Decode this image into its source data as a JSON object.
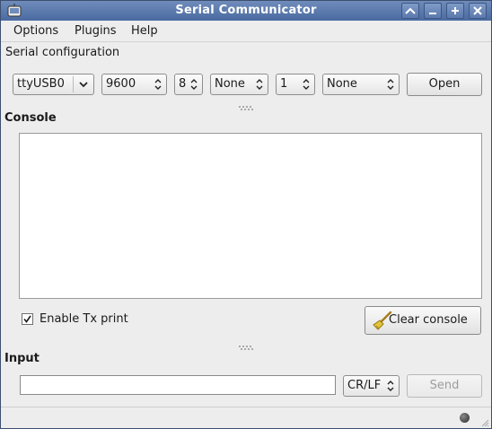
{
  "window": {
    "title": "Serial Communicator",
    "buttons": [
      "up-icon",
      "minimize-icon",
      "maximize-icon",
      "close-icon"
    ]
  },
  "menu": {
    "options": "Options",
    "plugins": "Plugins",
    "help": "Help"
  },
  "serial_config": {
    "label": "Serial configuration",
    "port": "ttyUSB0",
    "baud": "9600",
    "data_bits": "8",
    "parity": "None",
    "stop_bits": "1",
    "flow_control": "None",
    "open_label": "Open"
  },
  "console": {
    "label": "Console",
    "content": "",
    "tx_print_label": "Enable Tx print",
    "tx_print_checked": true,
    "clear_label": "Clear console"
  },
  "input": {
    "label": "Input",
    "value": "",
    "line_ending": "CR/LF",
    "send_label": "Send"
  },
  "colors": {
    "titlebar": "#5574a8",
    "console_bg": "#ffffff",
    "broom_handle": "#a87b1e",
    "broom_bristles": "#e2c43a"
  }
}
